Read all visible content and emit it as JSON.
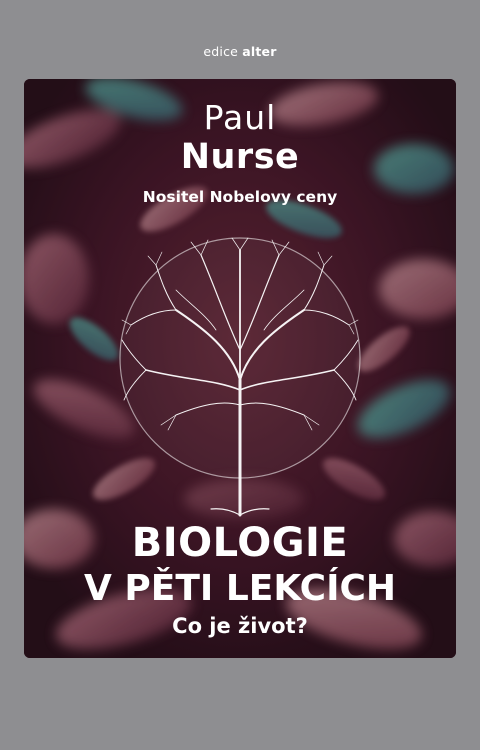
{
  "edition": {
    "prefix": "edice",
    "brand": "alter"
  },
  "cover": {
    "author_first": "Paul",
    "author_last": "Nurse",
    "author_note": "Nositel Nobelovy ceny",
    "title_line1": "BIOLOGIE",
    "title_line2": "V PĚTI LEKCÍCH",
    "tagline": "Co je život?",
    "illustration": "tree-of-life-icon"
  },
  "colors": {
    "page_background": "#8e8e91",
    "cover_background": "#3a1522",
    "text": "#ffffff"
  }
}
